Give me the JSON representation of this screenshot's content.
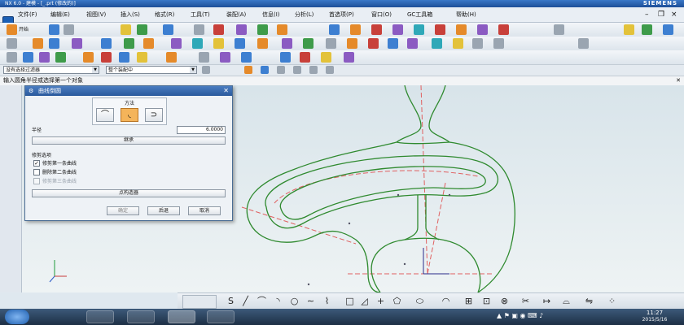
{
  "window": {
    "title": "NX 6.0 - 建模 - [_.prt (修改的)]",
    "brand": "SIEMENS"
  },
  "menu": {
    "items": [
      "文件(F)",
      "编辑(E)",
      "视图(V)",
      "插入(S)",
      "格式(R)",
      "工具(T)",
      "装配(A)",
      "信息(I)",
      "分析(L)",
      "首选项(P)",
      "窗口(O)",
      "GC工具箱",
      "帮助(H)"
    ]
  },
  "toolbar": {
    "start_label": "开始"
  },
  "filter": {
    "type_filter": "没有选择过滤器",
    "scope": "整个装配中"
  },
  "cue": {
    "prompt": "输入圆角半径或选择第一个对象",
    "close": "✕"
  },
  "dialog": {
    "title": "曲线倒圆",
    "method_label": "方法",
    "radius_label": "半径",
    "radius_value": "6.0000",
    "inherit_button": "继承",
    "trim_section_label": "修剪选项",
    "trim_first": {
      "label": "修剪第一条曲线",
      "checked": true
    },
    "trim_second": {
      "label": "删除第二条曲线",
      "checked": false
    },
    "trim_third": {
      "label": "修剪第三条曲线",
      "checked": false
    },
    "point_constructor_button": "点构造器",
    "ok_button": "确定",
    "back_button": "后退",
    "cancel_button": "取消"
  },
  "taskbar": {
    "time": "11:27",
    "date": "2015/5/16"
  },
  "colors": {
    "curve": "#2f8a2f",
    "centerline": "#e06060",
    "dialog_header": "#2a5a9c"
  }
}
